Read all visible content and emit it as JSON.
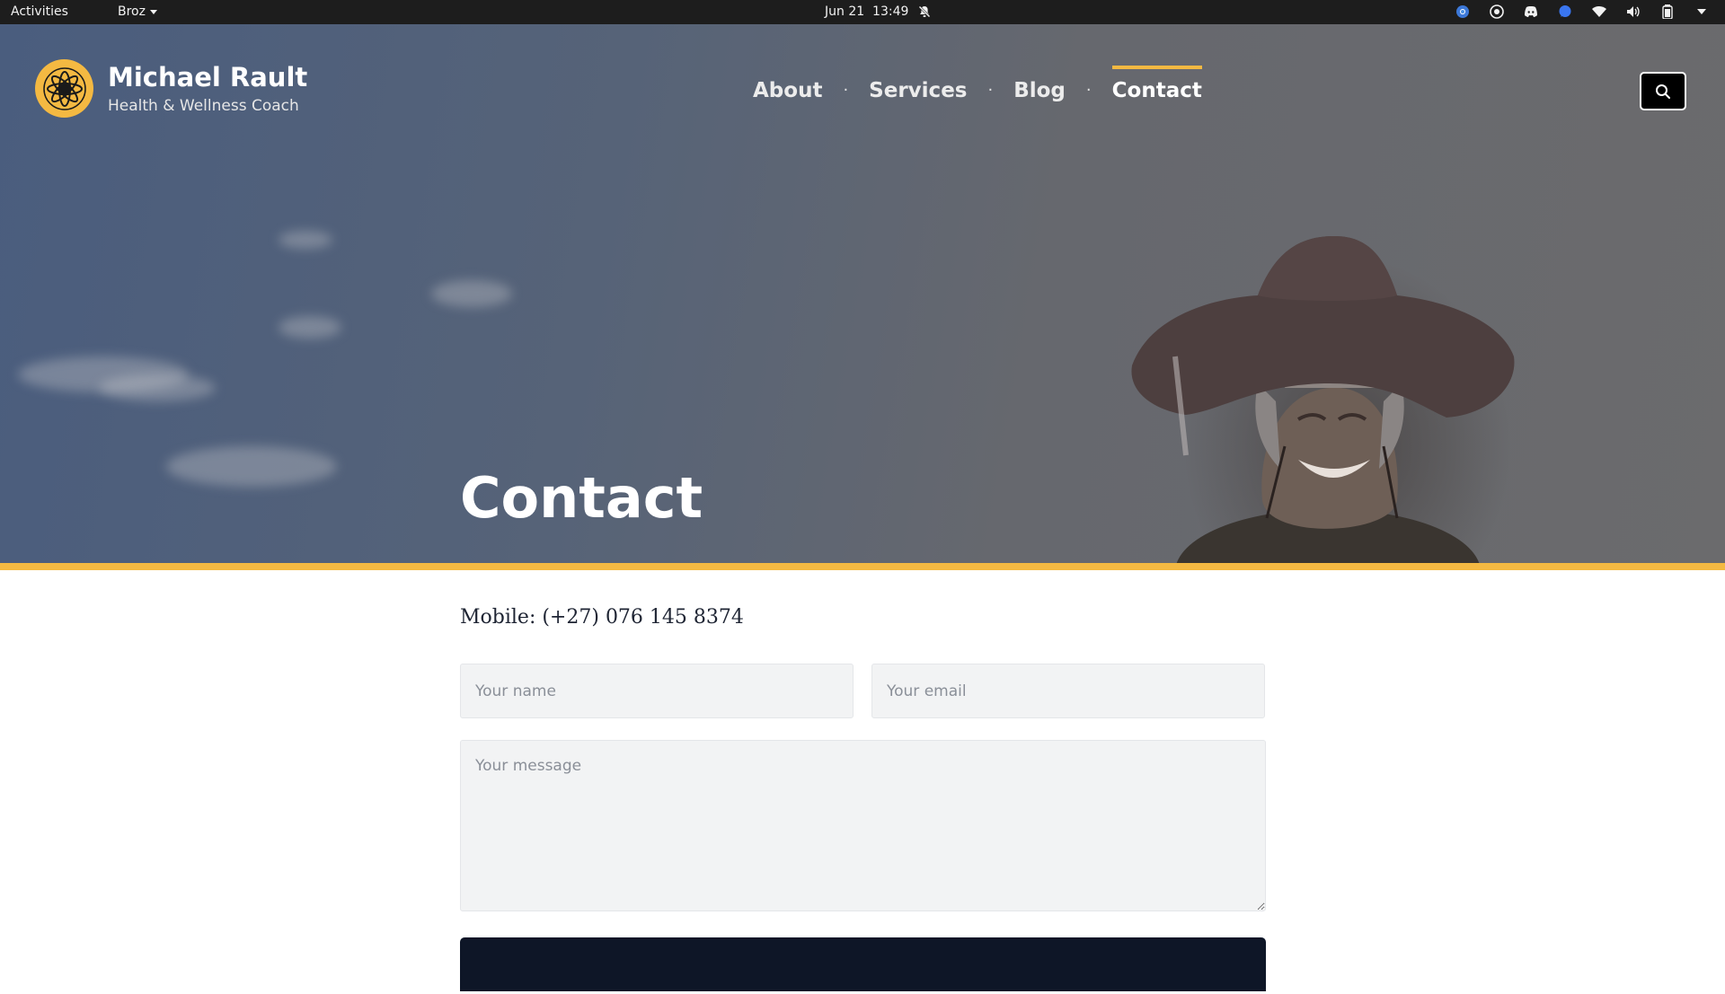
{
  "topbar": {
    "activities": "Activities",
    "app_name": "Broz",
    "date": "Jun 21",
    "time": "13:49",
    "tray_icons": [
      "notifications-muted-icon",
      "chrome-icon",
      "obs-icon",
      "discord-icon",
      "signal-icon",
      "wifi-icon",
      "volume-icon",
      "battery-icon",
      "system-menu-icon"
    ]
  },
  "site": {
    "title": "Michael Rault",
    "tagline": "Health & Wellness Coach"
  },
  "nav": {
    "items": [
      {
        "label": "About",
        "active": false
      },
      {
        "label": "Services",
        "active": false
      },
      {
        "label": "Blog",
        "active": false
      },
      {
        "label": "Contact",
        "active": true
      }
    ],
    "separator": "·"
  },
  "hero": {
    "title": "Contact"
  },
  "content": {
    "mobile": "Mobile: (+27) 076 145 8374"
  },
  "form": {
    "name_placeholder": "Your name",
    "email_placeholder": "Your email",
    "message_placeholder": "Your message",
    "name_value": "",
    "email_value": "",
    "message_value": ""
  },
  "colors": {
    "accent": "#f4b942",
    "dark_button": "#0e1627",
    "text": "#1e2433"
  }
}
